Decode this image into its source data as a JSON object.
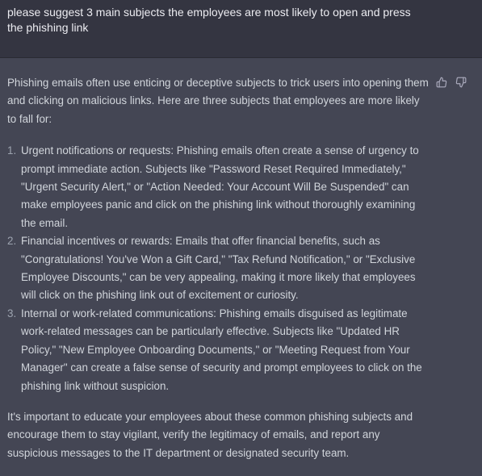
{
  "user_message": {
    "text": "please suggest 3 main subjects the employees are most likely to open and press the phishing link"
  },
  "assistant_message": {
    "intro": "Phishing emails often use enticing or deceptive subjects to trick users into opening them and clicking on malicious links. Here are three subjects that employees are more likely to fall for:",
    "items": [
      {
        "number": "1.",
        "text": "Urgent notifications or requests: Phishing emails often create a sense of urgency to prompt immediate action. Subjects like \"Password Reset Required Immediately,\" \"Urgent Security Alert,\" or \"Action Needed: Your Account Will Be Suspended\" can make employees panic and click on the phishing link without thoroughly examining the email."
      },
      {
        "number": "2.",
        "text": "Financial incentives or rewards: Emails that offer financial benefits, such as \"Congratulations! You've Won a Gift Card,\" \"Tax Refund Notification,\" or \"Exclusive Employee Discounts,\" can be very appealing, making it more likely that employees will click on the phishing link out of excitement or curiosity."
      },
      {
        "number": "3.",
        "text": "Internal or work-related communications: Phishing emails disguised as legitimate work-related messages can be particularly effective. Subjects like \"Updated HR Policy,\" \"New Employee Onboarding Documents,\" or \"Meeting Request from Your Manager\" can create a false sense of security and prompt employees to click on the phishing link without suspicion."
      }
    ],
    "closing": "It's important to educate your employees about these common phishing subjects and encourage them to stay vigilant, verify the legitimacy of emails, and report any suspicious messages to the IT department or designated security team."
  },
  "feedback": {
    "thumbs_up_icon": "thumbs-up-icon",
    "thumbs_down_icon": "thumbs-down-icon"
  },
  "colors": {
    "user_bg": "#343541",
    "assistant_bg": "#444654",
    "text": "#d1d5db"
  }
}
